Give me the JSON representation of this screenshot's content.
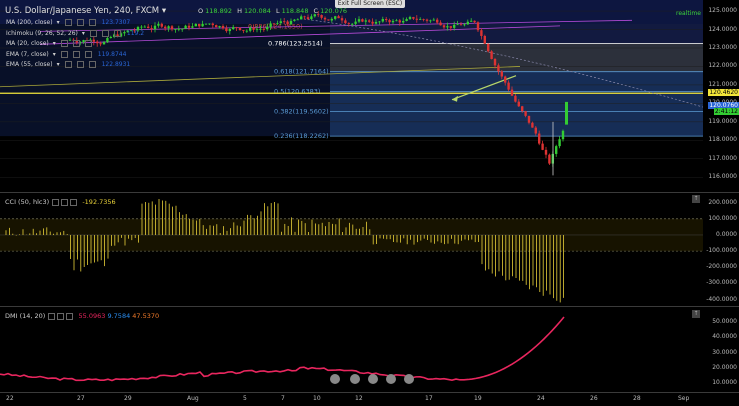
{
  "header": {
    "title": "U.S. Dollar/Japanese Yen, 240, FXCM",
    "ohlc": [
      {
        "k": "O",
        "v": "118.892"
      },
      {
        "k": "H",
        "v": "120.084"
      },
      {
        "k": "L",
        "v": "118.848"
      },
      {
        "k": "C",
        "v": "120.076"
      }
    ],
    "exit_fullscreen": "Exit Full Screen (ESC)",
    "realtime": "realtime"
  },
  "indicators": [
    {
      "label": "MA (200, close)",
      "value": "123.7307",
      "color": "#2a66d6"
    },
    {
      "label": "Ichimoku (9, 26, 52, 26)",
      "value": "119.2",
      "color": "#2a66d6"
    },
    {
      "label": "MA (20, close)",
      "value": "",
      "color": "#cc3333"
    },
    {
      "label": "EMA (7, close)",
      "value": "119.8744",
      "color": "#2a66d6"
    },
    {
      "label": "EMA (55, close)",
      "value": "122.8931",
      "color": "#2a66d6"
    }
  ],
  "fib": {
    "levels": [
      {
        "label": "0.786(123.2514)",
        "price": 123.2514,
        "color": "#ffffff"
      },
      {
        "label": "0.618(121.7164)",
        "price": 121.7164,
        "color": "#5b9bd5"
      },
      {
        "label": "0.5(120.6383)",
        "price": 120.6383,
        "color": "#5b9bd5"
      },
      {
        "label": "0.382(119.5602)",
        "price": 119.5602,
        "color": "#5b9bd5"
      },
      {
        "label": "0.236(118.2262)",
        "price": 118.2262,
        "color": "#5b9bd5"
      }
    ],
    "extra_label": "0.886(124.1650)"
  },
  "price_axis": {
    "ticks": [
      "125.0000",
      "124.0000",
      "123.0000",
      "122.0000",
      "121.0000",
      "120.0000",
      "119.0000",
      "118.0000",
      "117.0000",
      "116.0000"
    ],
    "last_price": "120.4620",
    "second_tag": "120.0760",
    "countdown": "2:41:12"
  },
  "cci": {
    "label": "CCI (50, hlc3)",
    "value": "-192.7356",
    "ticks": [
      "200.0000",
      "100.0000",
      "0.0000",
      "-100.0000",
      "-200.0000",
      "-300.0000",
      "-400.0000"
    ]
  },
  "dmi": {
    "label": "DMI (14, 20)",
    "values": [
      {
        "v": "55.0963",
        "color": "#e8265e"
      },
      {
        "v": "9.7584",
        "color": "#2a8df0"
      },
      {
        "v": "47.5370",
        "color": "#f07a2a"
      }
    ],
    "ticks": [
      "50.0000",
      "40.0000",
      "30.0000",
      "20.0000",
      "10.0000"
    ]
  },
  "time_axis": {
    "labels": [
      "22",
      "27",
      "29",
      "Aug",
      "5",
      "7",
      "10",
      "12",
      "17",
      "19",
      "24",
      "26",
      "28",
      "Sep"
    ]
  }
}
